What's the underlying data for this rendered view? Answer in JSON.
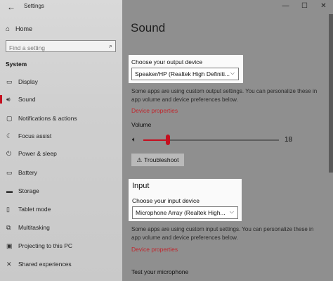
{
  "window": {
    "title": "Settings",
    "controls": [
      "—",
      "☐",
      "✕"
    ]
  },
  "sidebar": {
    "home": "Home",
    "search_placeholder": "Find a setting",
    "section": "System",
    "items": [
      {
        "label": "Display",
        "icon": "display-icon"
      },
      {
        "label": "Sound",
        "icon": "speaker-icon",
        "selected": true
      },
      {
        "label": "Notifications & actions",
        "icon": "notifications-icon"
      },
      {
        "label": "Focus assist",
        "icon": "moon-icon"
      },
      {
        "label": "Power & sleep",
        "icon": "power-icon"
      },
      {
        "label": "Battery",
        "icon": "battery-icon"
      },
      {
        "label": "Storage",
        "icon": "storage-icon"
      },
      {
        "label": "Tablet mode",
        "icon": "tablet-icon"
      },
      {
        "label": "Multitasking",
        "icon": "multitasking-icon"
      },
      {
        "label": "Projecting to this PC",
        "icon": "projecting-icon"
      },
      {
        "label": "Shared experiences",
        "icon": "shared-experiences-icon"
      }
    ]
  },
  "main": {
    "title": "Sound",
    "output": {
      "label": "Choose your output device",
      "device": "Speaker/HP (Realtek High Definiti...",
      "info": "Some apps are using custom output settings. You can personalize these in app volume and device preferences below.",
      "link": "Device properties",
      "volume_label": "Volume",
      "volume_value": "18",
      "volume_fraction": 0.18,
      "troubleshoot": "Troubleshoot"
    },
    "input": {
      "heading": "Input",
      "label": "Choose your input device",
      "device": "Microphone Array (Realtek High...",
      "info": "Some apps are using custom input settings. You can personalize these in app volume and device preferences below.",
      "link": "Device properties",
      "test_label": "Test your microphone"
    }
  },
  "colors": {
    "accent": "#c50f1f",
    "link": "#c0262d"
  }
}
